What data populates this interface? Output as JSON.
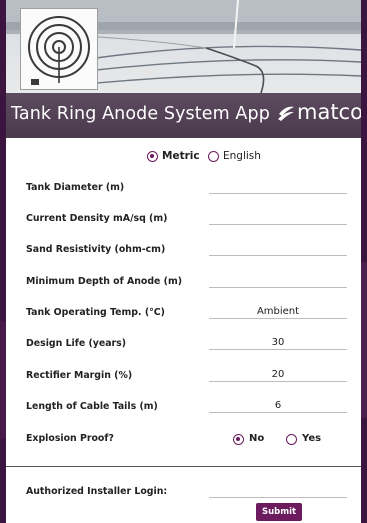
{
  "header": {
    "title": "Tank Ring Anode System App",
    "brand": "matcor",
    "logo_icon": "concentric-rings-logo"
  },
  "units": {
    "metric_label": "Metric",
    "english_label": "English",
    "selected": "Metric"
  },
  "fields": [
    {
      "label": "Tank Diameter (m)",
      "value": ""
    },
    {
      "label": "Current Density mA/sq (m)",
      "value": ""
    },
    {
      "label": "Sand Resistivity (ohm-cm)",
      "value": ""
    },
    {
      "label": "Minimum Depth of Anode (m)",
      "value": ""
    },
    {
      "label": "Tank Operating Temp. (°C)",
      "value": "Ambient"
    },
    {
      "label": "Design Life (years)",
      "value": "30"
    },
    {
      "label": "Rectifier Margin (%)",
      "value": "20"
    },
    {
      "label": "Length of Cable Tails (m)",
      "value": "6"
    }
  ],
  "explosion": {
    "label": "Explosion Proof?",
    "no_label": "No",
    "yes_label": "Yes",
    "selected": "No"
  },
  "login": {
    "label": "Authorized Installer Login:",
    "value": "",
    "submit_label": "Submit"
  },
  "colors": {
    "accent": "#6b1b5e",
    "background": "#3c1440",
    "titlebar": "#4b3a4e"
  }
}
